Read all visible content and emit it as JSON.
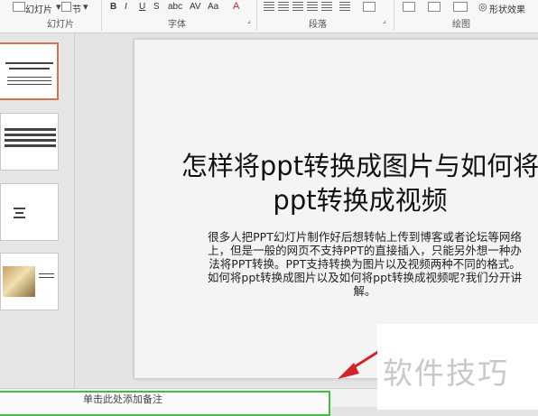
{
  "ribbon": {
    "slides_group": {
      "layout_label": "幻灯片",
      "section_label": "节",
      "group_label": "幻灯片"
    },
    "font_group": {
      "bold": "B",
      "italic": "I",
      "underline": "U",
      "strike": "S",
      "size_label": "Aa",
      "group_label": "字体"
    },
    "paragraph_group": {
      "group_label": "段落"
    },
    "drawing_group": {
      "group_label": "绘图",
      "shape_effects_label": "形状效果"
    }
  },
  "thumbnails": [
    {
      "index": 1,
      "selected": true
    },
    {
      "index": 2,
      "selected": false
    },
    {
      "index": 3,
      "selected": false
    },
    {
      "index": 4,
      "selected": false
    }
  ],
  "slide": {
    "title": "怎样将ppt转换成图片与如何将ppt转换成视频",
    "body": "很多人把PPT幻灯片制作好后想转帖上传到博客或者论坛等网络上，但是一般的网页不支持PPT的直接插入，只能另外想一种办法将PPT转换。PPT支持转换为图片以及视频两种不同的格式。如何将ppt转换成图片以及如何将ppt转换成视频呢?我们分开讲解。"
  },
  "notes": {
    "placeholder": "单击此处添加备注"
  },
  "watermark": {
    "text": "软件技巧"
  },
  "colors": {
    "selected_thumb_border": "#d0764a",
    "annotation_arrow": "#d0262a",
    "notes_highlight": "#3fbf3f"
  }
}
